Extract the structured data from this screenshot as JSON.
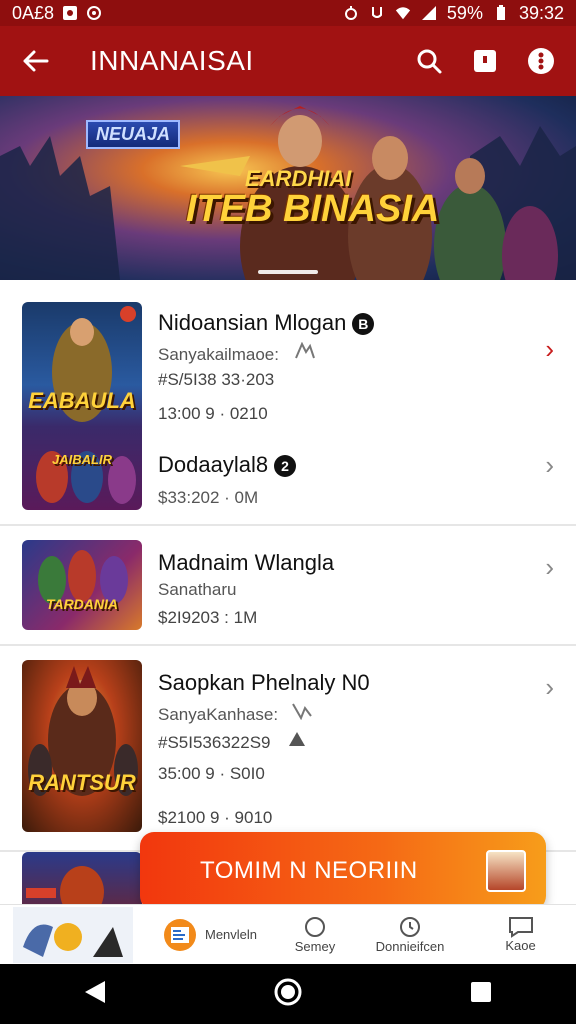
{
  "status_bar": {
    "time_left": "0A£8",
    "battery": "59%",
    "clock": "39:32"
  },
  "app_bar": {
    "title": "INNANAISAI"
  },
  "banner": {
    "tag": "NEUAJA",
    "sub": "EARDHIAI",
    "main": "ITEB BINASIA"
  },
  "list": {
    "items": [
      {
        "title": "Nidoansian Mlogan",
        "badge": "B",
        "subtitle": "Sanyakailmaoe:",
        "line2": "#S/5I38 33·203",
        "line3": "13:00 9 · 0210",
        "thumb_label": "EABAULA"
      },
      {
        "title": "Dodaaylal8",
        "badge": "2",
        "subtitle": "$33:202 · 0M",
        "thumb_label": "JAIBALIR"
      },
      {
        "title": "Madnaim Wlangla",
        "subtitle": "Sanatharu",
        "line2": "$2I9203 : 1M",
        "thumb_label": "TARDANIA"
      },
      {
        "title": "Saopkan Phelnaly N0",
        "subtitle": "SanyaKanhase:",
        "line2": "#S5I536322S9",
        "line3": "35:00 9 · S0I0",
        "line4": "$2100 9 · 9010",
        "thumb_label": "RANTSUR"
      }
    ]
  },
  "cta": {
    "label": "TOMIM N NEORIIN"
  },
  "bottom_nav": {
    "items": [
      {
        "label": ""
      },
      {
        "label": "Menvleln"
      },
      {
        "label": "Semey"
      },
      {
        "label": "Donnieifcen"
      },
      {
        "label": "Kaoe"
      }
    ]
  },
  "colors": {
    "app_bar": "#a11212",
    "status_bar": "#8e0e0e",
    "cta_start": "#f2370e",
    "cta_end": "#f79d1a"
  }
}
